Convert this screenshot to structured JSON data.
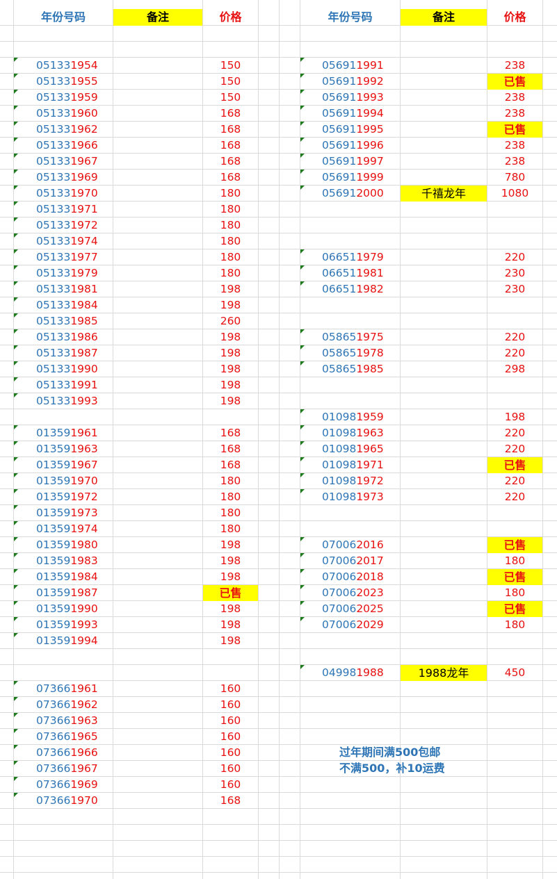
{
  "headers": {
    "year_code": "年份号码",
    "note": "备注",
    "price": "价格"
  },
  "colors": {
    "code_blue": "#2e75b6",
    "price_red": "#e81010",
    "highlight_yellow": "#ffff00",
    "flag_green": "#1e7b1e",
    "gridline": "#dadada"
  },
  "left_rows": [
    {
      "row": 3,
      "prefix": "05133",
      "suffix": "1954",
      "price": "150"
    },
    {
      "row": 4,
      "prefix": "05133",
      "suffix": "1955",
      "price": "150"
    },
    {
      "row": 5,
      "prefix": "05133",
      "suffix": "1959",
      "price": "150"
    },
    {
      "row": 6,
      "prefix": "05133",
      "suffix": "1960",
      "price": "168"
    },
    {
      "row": 7,
      "prefix": "05133",
      "suffix": "1962",
      "price": "168"
    },
    {
      "row": 8,
      "prefix": "05133",
      "suffix": "1966",
      "price": "168"
    },
    {
      "row": 9,
      "prefix": "05133",
      "suffix": "1967",
      "price": "168"
    },
    {
      "row": 10,
      "prefix": "05133",
      "suffix": "1969",
      "price": "168"
    },
    {
      "row": 11,
      "prefix": "05133",
      "suffix": "1970",
      "price": "180"
    },
    {
      "row": 12,
      "prefix": "05133",
      "suffix": "1971",
      "price": "180"
    },
    {
      "row": 13,
      "prefix": "05133",
      "suffix": "1972",
      "price": "180"
    },
    {
      "row": 14,
      "prefix": "05133",
      "suffix": "1974",
      "price": "180"
    },
    {
      "row": 15,
      "prefix": "05133",
      "suffix": "1977",
      "price": "180"
    },
    {
      "row": 16,
      "prefix": "05133",
      "suffix": "1979",
      "price": "180"
    },
    {
      "row": 17,
      "prefix": "05133",
      "suffix": "1981",
      "price": "198"
    },
    {
      "row": 18,
      "prefix": "05133",
      "suffix": "1984",
      "price": "198"
    },
    {
      "row": 19,
      "prefix": "05133",
      "suffix": "1985",
      "price": "260"
    },
    {
      "row": 20,
      "prefix": "05133",
      "suffix": "1986",
      "price": "198"
    },
    {
      "row": 21,
      "prefix": "05133",
      "suffix": "1987",
      "price": "198"
    },
    {
      "row": 22,
      "prefix": "05133",
      "suffix": "1990",
      "price": "198"
    },
    {
      "row": 23,
      "prefix": "05133",
      "suffix": "1991",
      "price": "198"
    },
    {
      "row": 24,
      "prefix": "05133",
      "suffix": "1993",
      "price": "198"
    },
    {
      "row": 26,
      "prefix": "01359",
      "suffix": "1961",
      "price": "168"
    },
    {
      "row": 27,
      "prefix": "01359",
      "suffix": "1963",
      "price": "168"
    },
    {
      "row": 28,
      "prefix": "01359",
      "suffix": "1967",
      "price": "168"
    },
    {
      "row": 29,
      "prefix": "01359",
      "suffix": "1970",
      "price": "180"
    },
    {
      "row": 30,
      "prefix": "01359",
      "suffix": "1972",
      "price": "180"
    },
    {
      "row": 31,
      "prefix": "01359",
      "suffix": "1973",
      "price": "180"
    },
    {
      "row": 32,
      "prefix": "01359",
      "suffix": "1974",
      "price": "180"
    },
    {
      "row": 33,
      "prefix": "01359",
      "suffix": "1980",
      "price": "198"
    },
    {
      "row": 34,
      "prefix": "01359",
      "suffix": "1983",
      "price": "198"
    },
    {
      "row": 35,
      "prefix": "01359",
      "suffix": "1984",
      "price": "198"
    },
    {
      "row": 36,
      "prefix": "01359",
      "suffix": "1987",
      "price": "已售",
      "sold": true
    },
    {
      "row": 37,
      "prefix": "01359",
      "suffix": "1990",
      "price": "198"
    },
    {
      "row": 38,
      "prefix": "01359",
      "suffix": "1993",
      "price": "198"
    },
    {
      "row": 39,
      "prefix": "01359",
      "suffix": "1994",
      "price": "198"
    },
    {
      "row": 42,
      "prefix": "07366",
      "suffix": "1961",
      "price": "160"
    },
    {
      "row": 43,
      "prefix": "07366",
      "suffix": "1962",
      "price": "160"
    },
    {
      "row": 44,
      "prefix": "07366",
      "suffix": "1963",
      "price": "160"
    },
    {
      "row": 45,
      "prefix": "07366",
      "suffix": "1965",
      "price": "160"
    },
    {
      "row": 46,
      "prefix": "07366",
      "suffix": "1966",
      "price": "160"
    },
    {
      "row": 47,
      "prefix": "07366",
      "suffix": "1967",
      "price": "160"
    },
    {
      "row": 48,
      "prefix": "07366",
      "suffix": "1969",
      "price": "160"
    },
    {
      "row": 49,
      "prefix": "07366",
      "suffix": "1970",
      "price": "168"
    }
  ],
  "right_rows": [
    {
      "row": 3,
      "prefix": "05691",
      "suffix": "1991",
      "price": "238"
    },
    {
      "row": 4,
      "prefix": "05691",
      "suffix": "1992",
      "price": "已售",
      "sold": true
    },
    {
      "row": 5,
      "prefix": "05691",
      "suffix": "1993",
      "price": "238"
    },
    {
      "row": 6,
      "prefix": "05691",
      "suffix": "1994",
      "price": "238"
    },
    {
      "row": 7,
      "prefix": "05691",
      "suffix": "1995",
      "price": "已售",
      "sold": true
    },
    {
      "row": 8,
      "prefix": "05691",
      "suffix": "1996",
      "price": "238"
    },
    {
      "row": 9,
      "prefix": "05691",
      "suffix": "1997",
      "price": "238"
    },
    {
      "row": 10,
      "prefix": "05691",
      "suffix": "1999",
      "price": "780"
    },
    {
      "row": 11,
      "prefix": "05691",
      "suffix": "2000",
      "price": "1080",
      "note": "千禧龙年"
    },
    {
      "row": 15,
      "prefix": "06651",
      "suffix": "1979",
      "price": "220"
    },
    {
      "row": 16,
      "prefix": "06651",
      "suffix": "1981",
      "price": "230"
    },
    {
      "row": 17,
      "prefix": "06651",
      "suffix": "1982",
      "price": "230"
    },
    {
      "row": 20,
      "prefix": "05865",
      "suffix": "1975",
      "price": "220"
    },
    {
      "row": 21,
      "prefix": "05865",
      "suffix": "1978",
      "price": "220"
    },
    {
      "row": 22,
      "prefix": "05865",
      "suffix": "1985",
      "price": "298"
    },
    {
      "row": 25,
      "prefix": "01098",
      "suffix": "1959",
      "price": "198"
    },
    {
      "row": 26,
      "prefix": "01098",
      "suffix": "1963",
      "price": "220"
    },
    {
      "row": 27,
      "prefix": "01098",
      "suffix": "1965",
      "price": "220"
    },
    {
      "row": 28,
      "prefix": "01098",
      "suffix": "1971",
      "price": "已售",
      "sold": true
    },
    {
      "row": 29,
      "prefix": "01098",
      "suffix": "1972",
      "price": "220"
    },
    {
      "row": 30,
      "prefix": "01098",
      "suffix": "1973",
      "price": "220"
    },
    {
      "row": 33,
      "prefix": "07006",
      "suffix": "2016",
      "price": "已售",
      "sold": true
    },
    {
      "row": 34,
      "prefix": "07006",
      "suffix": "2017",
      "price": "180"
    },
    {
      "row": 35,
      "prefix": "07006",
      "suffix": "2018",
      "price": "已售",
      "sold": true
    },
    {
      "row": 36,
      "prefix": "07006",
      "suffix": "2023",
      "price": "180"
    },
    {
      "row": 37,
      "prefix": "07006",
      "suffix": "2025",
      "price": "已售",
      "sold": true
    },
    {
      "row": 38,
      "prefix": "07006",
      "suffix": "2029",
      "price": "180"
    },
    {
      "row": 41,
      "prefix": "04998",
      "suffix": "1988",
      "price": "450",
      "note": "1988龙年"
    }
  ],
  "footer": {
    "line1": "过年期间满500包邮",
    "line2": "不满500，补10运费"
  }
}
